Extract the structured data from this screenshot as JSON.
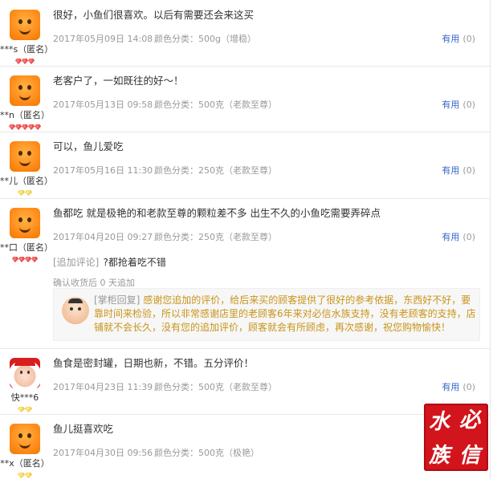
{
  "reviews": [
    {
      "user": "***s（匿名）",
      "badge": "red-gems-3",
      "text": "很好，小鱼们很喜欢。以后有需要还会来这买",
      "date": "2017年05月09日 14:08",
      "sku": "颜色分类：500g（增稳）",
      "useful_label": "有用",
      "useful_count": "(0)"
    },
    {
      "user": "**n（匿名）",
      "badge": "red-gems-5",
      "text": "老客户了，一如既往的好～！",
      "date": "2017年05月13日 09:58",
      "sku": "颜色分类：500克（老款至尊）",
      "useful_label": "有用",
      "useful_count": "(0)"
    },
    {
      "user": "**儿（匿名）",
      "badge": "gold-gems-2",
      "text": "可以，鱼儿爱吃",
      "date": "2017年05月16日 11:30",
      "sku": "颜色分类：250克（老款至尊）",
      "useful_label": "有用",
      "useful_count": "(0)"
    },
    {
      "user": "**口（匿名）",
      "badge": "red-gems-4",
      "text": "鱼都吃 就是极艳的和老款至尊的颗粒差不多 出生不久的小鱼吃需要弄碎点",
      "date": "2017年04月20日 09:27",
      "sku": "颜色分类：250克（老款至尊）",
      "useful_label": "有用",
      "useful_count": "(0)",
      "append_tag": "[追加评论]",
      "append_text": "?都抢着吃不错",
      "append_days": "确认收货后 0 天追加",
      "reply_tag": "[掌柜回复]",
      "reply_text": "感谢您追加的评价，给后来买的顾客提供了很好的参考依据，东西好不好，要靠时间来检验，所以非常感谢店里的老顾客6年来对必信水族支持，没有老顾客的支持，店铺就不会长久，没有您的追加评价，顾客就会有所顾虑，再次感谢，祝您购物愉快！"
    },
    {
      "user": "快***6",
      "badge": "gold-gems-2",
      "text": "鱼食是密封罐，日期也新，不错。五分评价！",
      "date": "2017年04月23日 11:39",
      "sku": "颜色分类：500克（老款至尊）",
      "useful_label": "有用",
      "useful_count": "(0)"
    },
    {
      "user": "**x（匿名）",
      "badge": "gold-gems-2",
      "text": "鱼儿挺喜欢吃",
      "date": "2017年04月30日 09:56",
      "sku": "颜色分类：500克（极艳）"
    }
  ],
  "watermark": [
    "水",
    "必",
    "族",
    "信"
  ]
}
